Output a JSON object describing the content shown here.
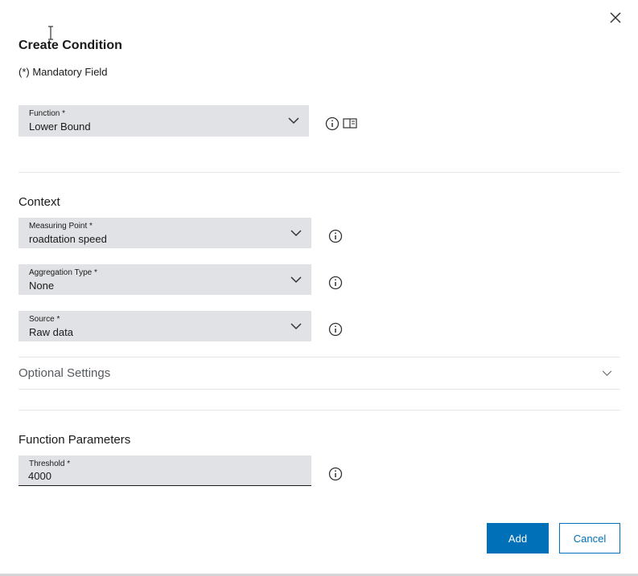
{
  "dialog": {
    "title": "Create Condition",
    "mandatory_note": "(*) Mandatory Field"
  },
  "function_field": {
    "label": "Function *",
    "value": "Lower Bound"
  },
  "context": {
    "title": "Context",
    "measuring_point": {
      "label": "Measuring Point *",
      "value": "roadtation speed"
    },
    "aggregation_type": {
      "label": "Aggregation Type *",
      "value": "None"
    },
    "source": {
      "label": "Source *",
      "value": "Raw data"
    }
  },
  "optional_settings": {
    "label": "Optional Settings"
  },
  "function_parameters": {
    "title": "Function Parameters",
    "threshold": {
      "label": "Threshold *",
      "value": "4000"
    }
  },
  "buttons": {
    "add": "Add",
    "cancel": "Cancel"
  },
  "colors": {
    "primary": "#0070b8",
    "field_background": "#e0e2e5",
    "divider": "#e3e5e8"
  },
  "icons": {
    "close": "close-icon",
    "info": "info-icon",
    "documentation": "book-icon",
    "chevron": "chevron-down-icon",
    "text_cursor": "text-cursor-icon"
  }
}
